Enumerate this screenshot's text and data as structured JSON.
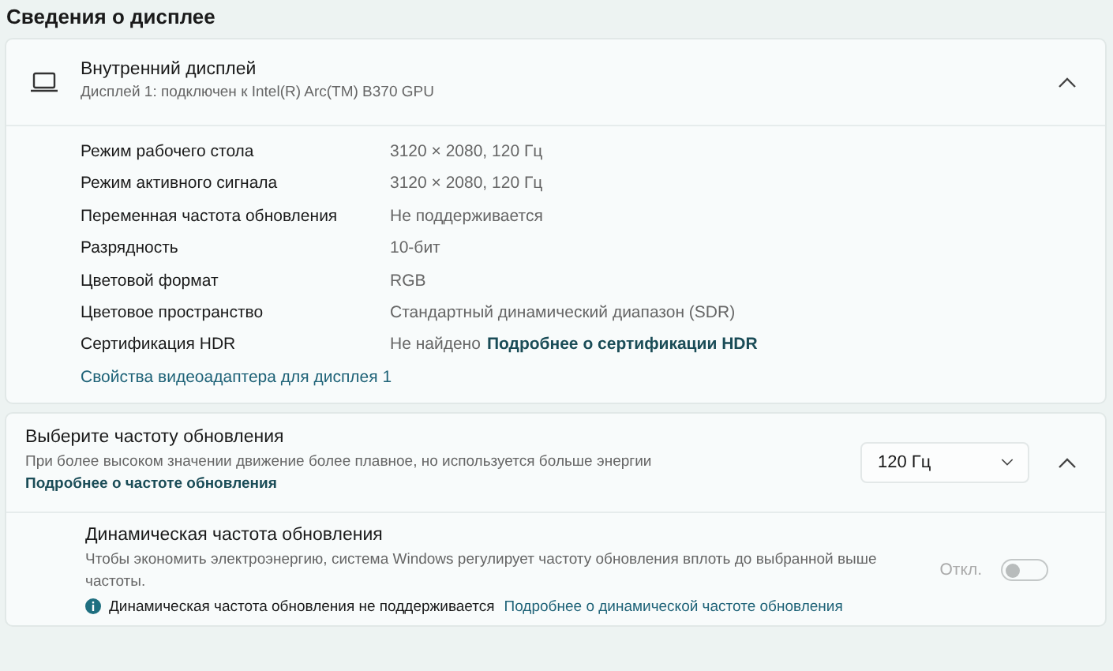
{
  "section_title": "Сведения о дисплее",
  "display": {
    "title": "Внутренний дисплей",
    "subtitle": "Дисплей 1: подключен к Intel(R) Arc(TM) B370 GPU",
    "expanded": true,
    "properties": [
      {
        "label": "Режим рабочего стола",
        "value": "3120 × 2080, 120 Гц"
      },
      {
        "label": "Режим активного сигнала",
        "value": "3120 × 2080, 120 Гц"
      },
      {
        "label": "Переменная частота обновления",
        "value": "Не поддерживается"
      },
      {
        "label": "Разрядность",
        "value": "10-бит"
      },
      {
        "label": "Цветовой формат",
        "value": "RGB"
      },
      {
        "label": "Цветовое пространство",
        "value": "Стандартный динамический диапазон (SDR)"
      },
      {
        "label": "Сертификация HDR",
        "value": "Не найдено",
        "link": "Подробнее о сертификации HDR"
      }
    ],
    "adapter_link": "Свойства видеоадаптера для дисплея 1"
  },
  "refresh": {
    "title": "Выберите частоту обновления",
    "description": "При более высоком значении движение более плавное, но используется больше энергии",
    "link": "Подробнее о частоте обновления",
    "dropdown_value": "120 Гц",
    "expanded": true,
    "dynamic": {
      "title": "Динамическая частота обновления",
      "description": "Чтобы экономить электроэнергию, система Windows регулирует частоту обновления вплоть до выбранной выше частоты.",
      "toggle_label": "Откл.",
      "on": false,
      "disabled": true,
      "note": "Динамическая частота обновления не поддерживается",
      "note_link": "Подробнее о динамической частоте обновления"
    }
  }
}
